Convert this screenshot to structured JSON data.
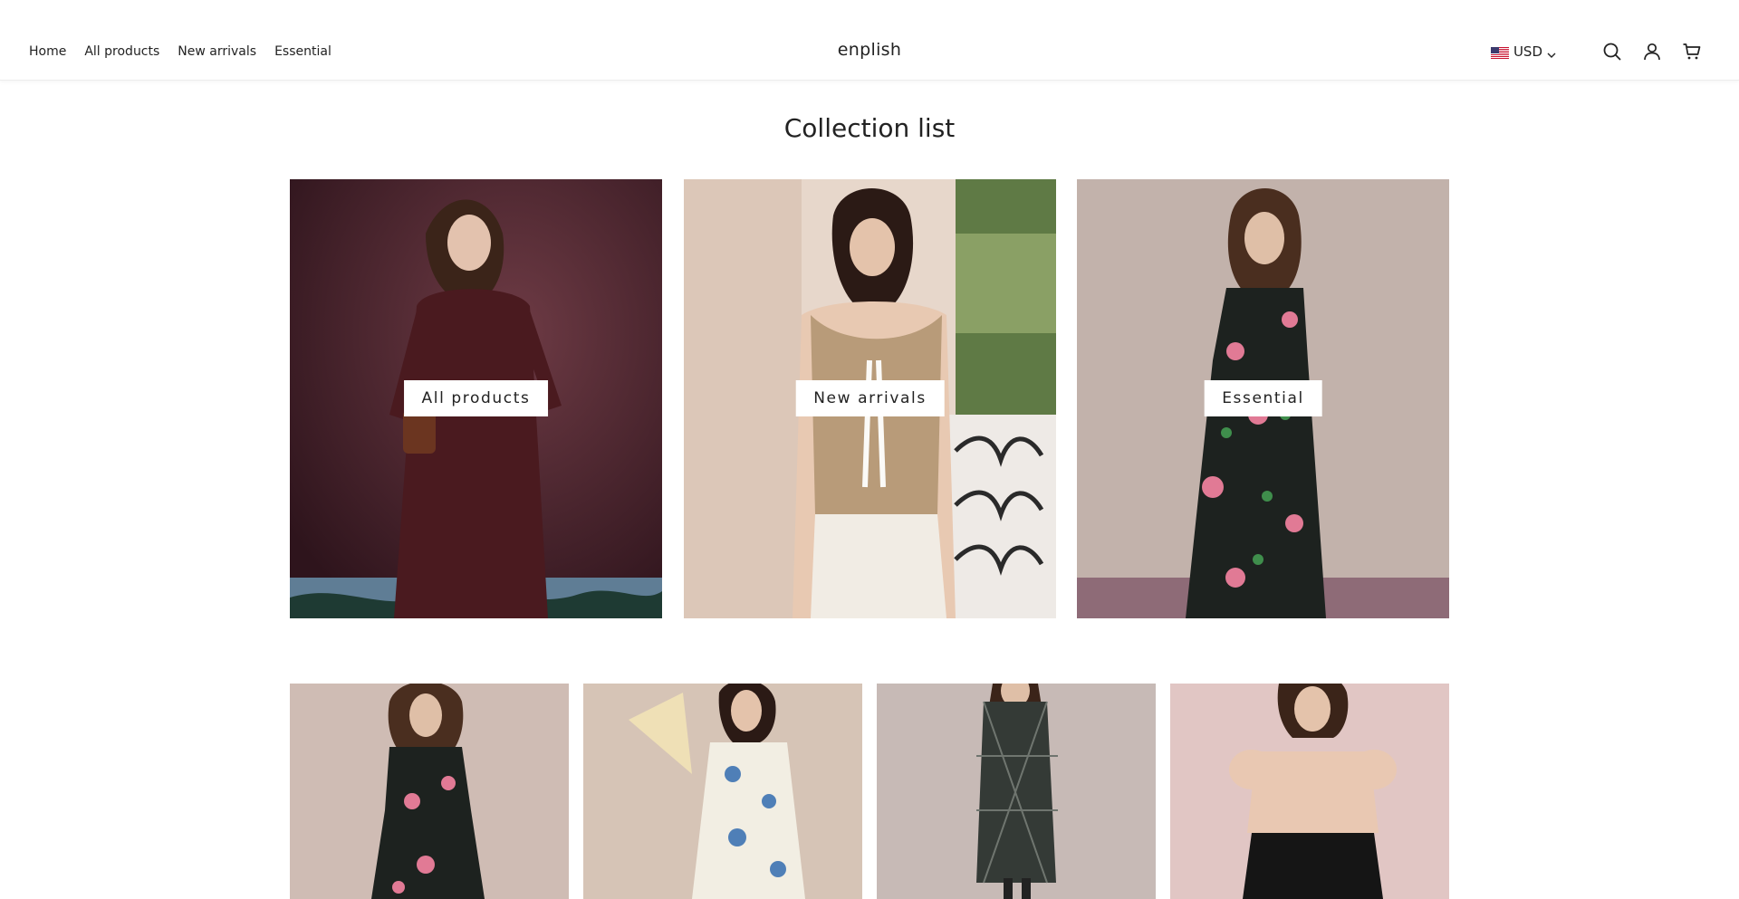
{
  "header": {
    "nav": [
      "Home",
      "All products",
      "New arrivals",
      "Essential"
    ],
    "logo": "enplish",
    "currency": "USD",
    "icons": [
      "us-flag-icon",
      "chevron-down-icon",
      "search-icon",
      "account-icon",
      "cart-icon"
    ]
  },
  "main": {
    "title": "Collection list",
    "collections": [
      {
        "label": "All products"
      },
      {
        "label": "New arrivals"
      },
      {
        "label": "Essential"
      }
    ],
    "products_visible": 4
  },
  "colors": {
    "text": "#222222",
    "background": "#ffffff",
    "divider": "#ececec"
  }
}
